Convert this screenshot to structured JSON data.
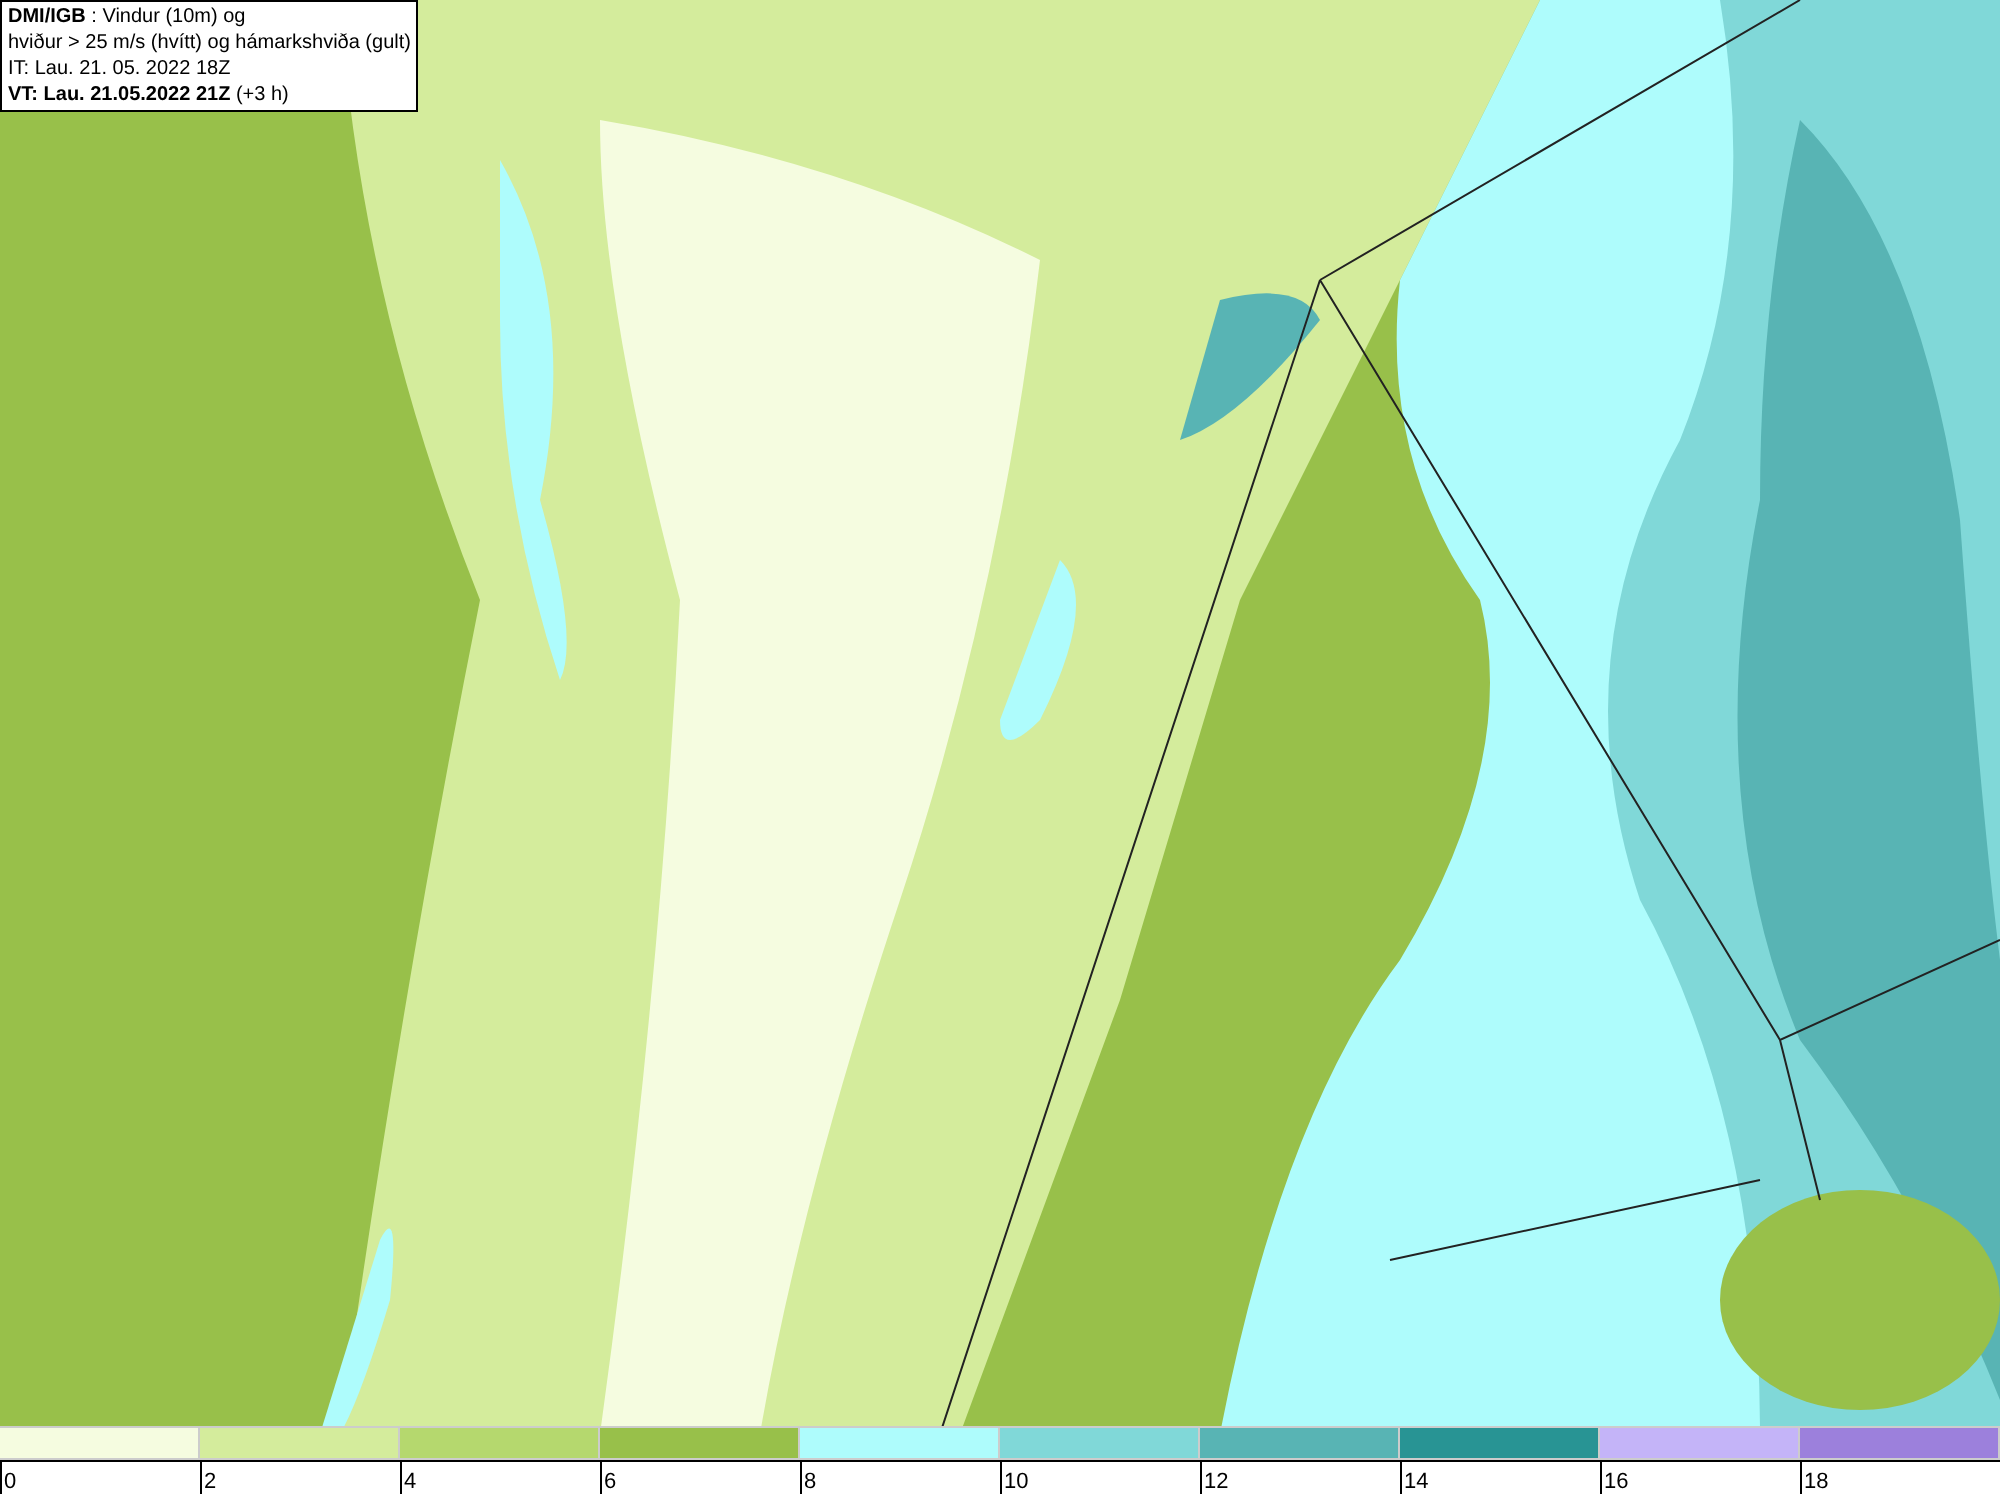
{
  "info_box": {
    "lines": [
      "**DMI/IGB** : Vindur (10m) og",
      "hviður > 25 m/s (hvítt) og hámarkshviða (gult)",
      "IT: Lau. 21. 05. 2022 18Z",
      "**VT: Lau. 21.05.2022 21Z** (+3 h)"
    ]
  },
  "legend": {
    "segments": [
      {
        "color": "#f5fce0"
      },
      {
        "color": "#d4ec9c"
      },
      {
        "color": "#b5d86e"
      },
      {
        "color": "#98c04a"
      },
      {
        "color": "#aefcfc"
      },
      {
        "color": "#80d8d8"
      },
      {
        "color": "#58b4b4"
      },
      {
        "color": "#289494"
      },
      {
        "color": "#c4b4f8"
      },
      {
        "color": "#9c80dc"
      }
    ],
    "ticks": [
      "0",
      "2",
      "4",
      "6",
      "8",
      "10",
      "12",
      "14",
      "16",
      "18"
    ]
  }
}
